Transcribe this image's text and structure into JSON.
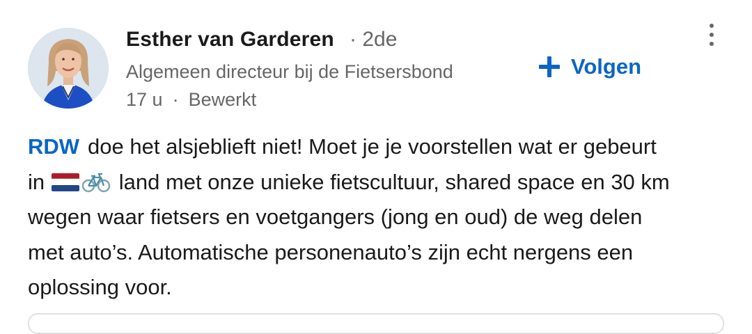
{
  "author": {
    "name": "Esther van Garderen",
    "degree": "· 2de",
    "headline": "Algemeen directeur bij de Fietsersbond",
    "time": "17 u",
    "separator": "·",
    "edited": "Bewerkt"
  },
  "follow_button": {
    "label": "Volgen"
  },
  "post": {
    "mention": "RDW",
    "line1_rest": "doe het alsjeblieft niet! Moet je je voorstellen wat er gebeurt",
    "line2_start": "in",
    "line2_rest": "land met onze unieke fietscultuur, shared space en 30 km",
    "line3": "wegen waar fietsers en voetgangers (jong en oud) de weg delen",
    "line4": "met auto’s. Automatische personenauto’s zijn echt nergens een",
    "line5": "oplossing voor.",
    "emojis": [
      "netherlands-flag",
      "bicycle"
    ]
  },
  "colors": {
    "link_blue": "#0a66c2",
    "secondary_text": "#666666",
    "primary_text": "#1a1a1a"
  }
}
